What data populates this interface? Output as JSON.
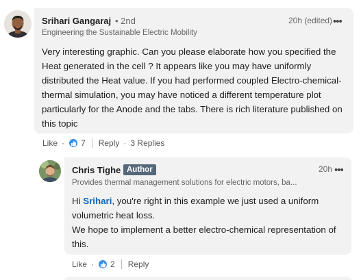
{
  "comments": [
    {
      "author": "Srihari Gangaraj",
      "degree": "• 2nd",
      "headline": "Engineering the Sustainable Electric Mobility",
      "time": "20h (edited)",
      "text": "Very interesting graphic. Can you please elaborate how you specified the Heat generated in the cell ? It appears like you may have uniformly distributed the Heat value. If you had performed coupled Electro-chemical-thermal simulation, you may have noticed a different temperature plot particularly for the Anode and the tabs. There is rich literature published on this topic",
      "actions": {
        "like": "Like",
        "dot": "·",
        "reaction_count": "7",
        "reply": "Reply",
        "replies": "3 Replies"
      }
    },
    {
      "author": "Chris Tighe",
      "badge": "Author",
      "headline": "Provides thermal management solutions for electric motors, ba...",
      "time": "20h",
      "text_prefix": "Hi ",
      "mention": "Srihari",
      "text_line1_rest": ", you're right in this example we just used a uniform volumetric heat loss.",
      "text_p2": "We hope to implement a better electro-chemical representation of this.",
      "actions": {
        "like": "Like",
        "dot": "·",
        "reaction_count": "2",
        "reply": "Reply"
      }
    }
  ],
  "more_glyph": "•••",
  "colors": {
    "bubble": "#f2f2f2",
    "link": "#0a66c2",
    "badge": "#56687a",
    "like": "#378fe9"
  }
}
